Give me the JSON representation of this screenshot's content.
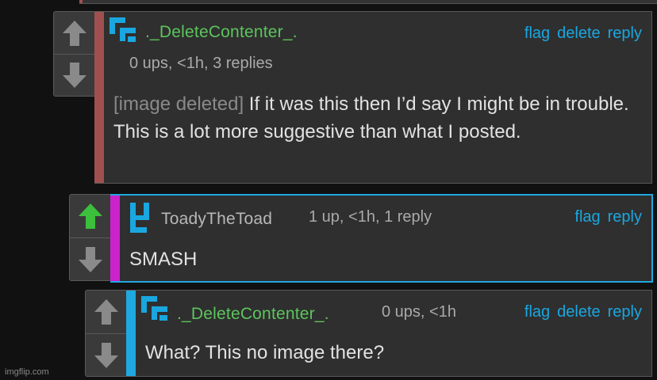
{
  "comments": [
    {
      "username": "._DeleteContenter_.",
      "meta": "0 ups, <1h, 3 replies",
      "actions": [
        "flag",
        "delete",
        "reply"
      ],
      "text_prefix": "[image deleted]",
      "text": " If it was this then I’d say I might be in trouble. This is a lot more suggestive than what I posted.",
      "upvoted": false,
      "accent_color": "#a05050"
    },
    {
      "username": "ToadyTheToad",
      "meta": "1 up, <1h, 1 reply",
      "actions": [
        "flag",
        "reply"
      ],
      "text": "SMASH",
      "upvoted": true,
      "accent_color": "#cc22cc",
      "border_color": "#20a8e0"
    },
    {
      "username": "._DeleteContenter_.",
      "meta": "0 ups, <1h",
      "actions": [
        "flag",
        "delete",
        "reply"
      ],
      "text": "What? This no image there?",
      "upvoted": false,
      "accent_color": "#20a8e0"
    }
  ],
  "colors": {
    "link": "#1aa7e0",
    "username": "#5cc55c",
    "upvote_active": "#3cbf3c",
    "arrow": "#8a8a8a",
    "avatar": "#1aa7e0"
  },
  "icons": [
    "up-arrow-icon",
    "down-arrow-icon",
    "avatar-icon"
  ],
  "watermark": "imgflip.com"
}
